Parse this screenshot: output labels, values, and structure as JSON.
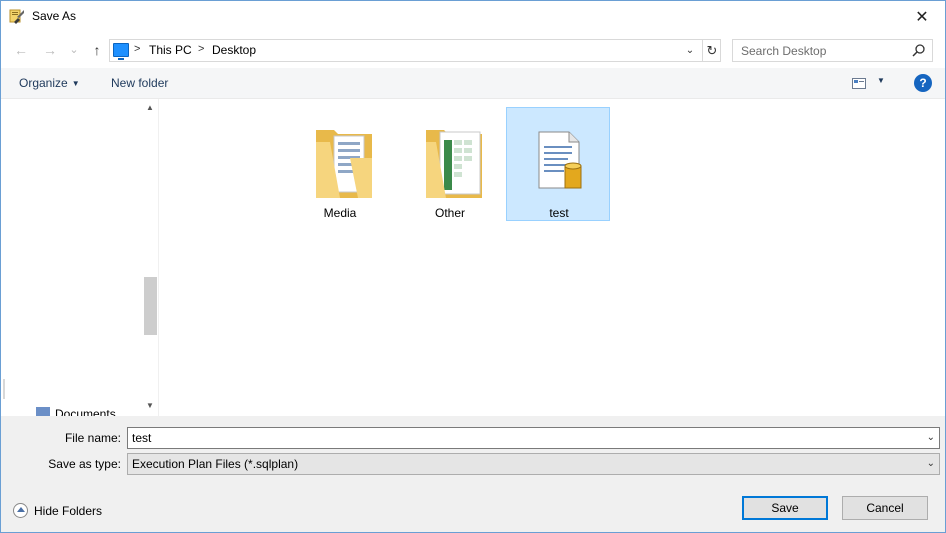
{
  "window": {
    "title": "Save As",
    "close_glyph": "✕"
  },
  "nav": {
    "back_glyph": "←",
    "forward_glyph": "→",
    "recent_glyph": "⌄",
    "up_glyph": "↑",
    "breadcrumb": [
      "This PC",
      "Desktop"
    ],
    "separator": ">",
    "dropdown_glyph": "⌄",
    "refresh_glyph": "↻"
  },
  "search": {
    "placeholder": "Search Desktop"
  },
  "commands": {
    "organize": "Organize",
    "organize_caret": "▼",
    "new_folder": "New folder",
    "view_caret": "▼",
    "help": "?"
  },
  "navpane": {
    "visible_item": "Documents",
    "scroll_up": "▲",
    "scroll_down": "▼"
  },
  "files": [
    {
      "name": "Media",
      "type": "folder",
      "icon": "folder-with-documents-icon",
      "selected": false
    },
    {
      "name": "Other",
      "type": "folder",
      "icon": "folder-with-spreadsheet-icon",
      "selected": false
    },
    {
      "name": "test",
      "type": "file",
      "icon": "sqlplan-file-icon",
      "selected": true
    }
  ],
  "form": {
    "file_name_label": "File name:",
    "file_name_value": "test",
    "save_type_label": "Save as type:",
    "save_type_value": "Execution Plan Files (*.sqlplan)",
    "dd_caret": "⌄"
  },
  "footer": {
    "hide_folders": "Hide Folders",
    "save": "Save",
    "cancel": "Cancel"
  },
  "colors": {
    "selection_bg": "#cce8ff",
    "selection_border": "#99d1ff",
    "primary_border": "#0078d7",
    "help_blue": "#1565c0"
  }
}
